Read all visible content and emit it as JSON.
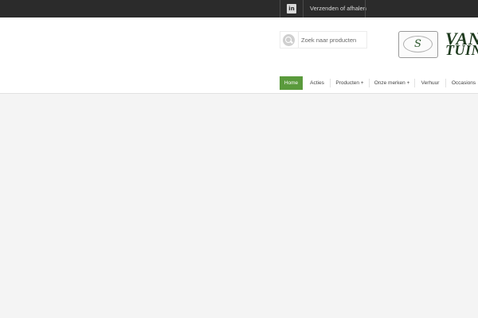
{
  "topbar": {
    "linkedin_icon_text": "in",
    "shipping_link": "Verzenden of afhalen"
  },
  "search": {
    "placeholder": "Zoek naar producten"
  },
  "logo": {
    "emblem_letter": "S",
    "word1": "VAN",
    "word2": "TUIN"
  },
  "nav": {
    "items": [
      {
        "label": "Home"
      },
      {
        "label": "Acties"
      },
      {
        "label": "Producten +"
      },
      {
        "label": "Onze merken +"
      },
      {
        "label": "Verhuur"
      },
      {
        "label": "Occasions"
      }
    ]
  },
  "colors": {
    "topbar": "#2b2b2b",
    "accent": "#5a9a3c",
    "background": "#f4f4f4"
  }
}
